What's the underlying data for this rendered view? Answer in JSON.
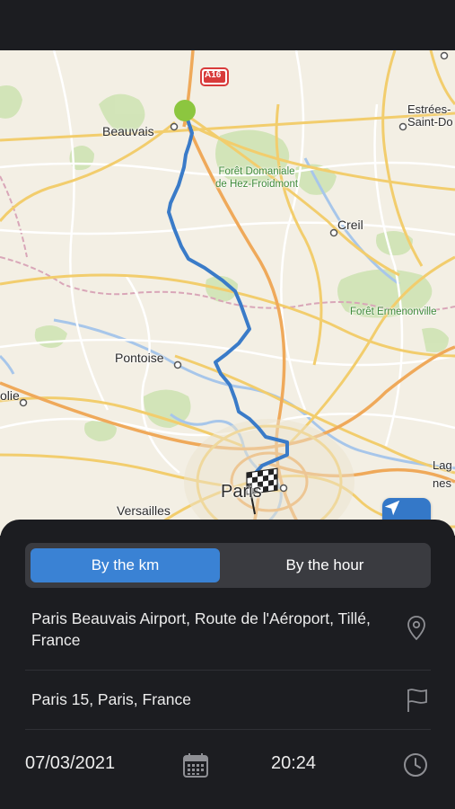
{
  "map": {
    "road_badge": "A16",
    "labels": {
      "beauvais": "Beauvais",
      "estrees": "Estrées-",
      "saint_do": "Saint-Do",
      "foret_hez_line1": "Forêt Domaniale",
      "foret_hez_line2": "de Hez-Froidmont",
      "creil": "Creil",
      "foret_ermenonville": "Forêt Ermenonville",
      "pontoise": "Pontoise",
      "olie": "olie",
      "paris": "Paris",
      "versailles": "Versailles",
      "lag": "Lag",
      "nes": "nes"
    },
    "locate_button": "location-arrow-icon"
  },
  "tabs": {
    "by_km": "By the km",
    "by_hour": "By the hour",
    "active": "By the km"
  },
  "pickup": {
    "address": "Paris Beauvais Airport, Route de l'Aéroport, Tillé, France",
    "icon": "location-pin-icon"
  },
  "destination": {
    "address": "Paris 15, Paris, France",
    "icon": "flag-icon"
  },
  "schedule": {
    "date": "07/03/2021",
    "time": "20:24",
    "date_icon": "calendar-icon",
    "time_icon": "clock-icon"
  },
  "colors": {
    "accent": "#3a82d4",
    "route": "#3a7bc8",
    "start_marker": "#8cc63f",
    "sheet_bg": "#1c1d21"
  }
}
